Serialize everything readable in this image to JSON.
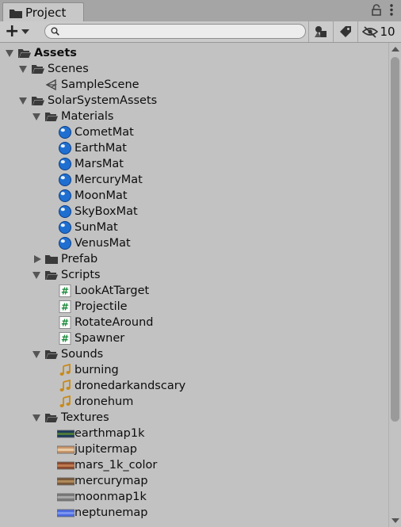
{
  "tab": {
    "title": "Project",
    "icon": "folder-icon"
  },
  "tab_controls": {
    "lock_icon": "lock-icon",
    "menu_icon": "kebab-menu-icon"
  },
  "toolbar": {
    "create_label": "+",
    "search": {
      "value": "",
      "placeholder": ""
    },
    "hidden_count": "10"
  },
  "tree": [
    {
      "label": "Assets",
      "depth": 0,
      "arrow": "open",
      "icon": "folder-open",
      "bold": true
    },
    {
      "label": "Scenes",
      "depth": 1,
      "arrow": "open",
      "icon": "folder-open"
    },
    {
      "label": "SampleScene",
      "depth": 2,
      "arrow": "",
      "icon": "scene"
    },
    {
      "label": "SolarSystemAssets",
      "depth": 1,
      "arrow": "open",
      "icon": "folder-open"
    },
    {
      "label": "Materials",
      "depth": 2,
      "arrow": "open",
      "icon": "folder-open"
    },
    {
      "label": "CometMat",
      "depth": 3,
      "arrow": "",
      "icon": "material"
    },
    {
      "label": "EarthMat",
      "depth": 3,
      "arrow": "",
      "icon": "material"
    },
    {
      "label": "MarsMat",
      "depth": 3,
      "arrow": "",
      "icon": "material"
    },
    {
      "label": "MercuryMat",
      "depth": 3,
      "arrow": "",
      "icon": "material"
    },
    {
      "label": "MoonMat",
      "depth": 3,
      "arrow": "",
      "icon": "material"
    },
    {
      "label": "SkyBoxMat",
      "depth": 3,
      "arrow": "",
      "icon": "material"
    },
    {
      "label": "SunMat",
      "depth": 3,
      "arrow": "",
      "icon": "material"
    },
    {
      "label": "VenusMat",
      "depth": 3,
      "arrow": "",
      "icon": "material"
    },
    {
      "label": "Prefab",
      "depth": 2,
      "arrow": "closed",
      "icon": "folder-closed"
    },
    {
      "label": "Scripts",
      "depth": 2,
      "arrow": "open",
      "icon": "folder-open"
    },
    {
      "label": "LookAtTarget",
      "depth": 3,
      "arrow": "",
      "icon": "script"
    },
    {
      "label": "Projectile",
      "depth": 3,
      "arrow": "",
      "icon": "script"
    },
    {
      "label": "RotateAround",
      "depth": 3,
      "arrow": "",
      "icon": "script"
    },
    {
      "label": "Spawner",
      "depth": 3,
      "arrow": "",
      "icon": "script"
    },
    {
      "label": "Sounds",
      "depth": 2,
      "arrow": "open",
      "icon": "folder-open"
    },
    {
      "label": "burning",
      "depth": 3,
      "arrow": "",
      "icon": "audio"
    },
    {
      "label": "dronedarkandscary",
      "depth": 3,
      "arrow": "",
      "icon": "audio"
    },
    {
      "label": "dronehum",
      "depth": 3,
      "arrow": "",
      "icon": "audio"
    },
    {
      "label": "Textures",
      "depth": 2,
      "arrow": "open",
      "icon": "folder-open"
    },
    {
      "label": "earthmap1k",
      "depth": 3,
      "arrow": "",
      "icon": "texture",
      "swatch": [
        "#1d3b5c",
        "#4d7a3a"
      ]
    },
    {
      "label": "jupitermap",
      "depth": 3,
      "arrow": "",
      "icon": "texture",
      "swatch": [
        "#c9966a",
        "#e9c9a4"
      ]
    },
    {
      "label": "mars_1k_color",
      "depth": 3,
      "arrow": "",
      "icon": "texture",
      "swatch": [
        "#8a4a2e",
        "#c07a4e"
      ]
    },
    {
      "label": "mercurymap",
      "depth": 3,
      "arrow": "",
      "icon": "texture",
      "swatch": [
        "#7a5a3a",
        "#b08a5a"
      ]
    },
    {
      "label": "moonmap1k",
      "depth": 3,
      "arrow": "",
      "icon": "texture",
      "swatch": [
        "#7a7a7a",
        "#a8a8a8"
      ]
    },
    {
      "label": "neptunemap",
      "depth": 3,
      "arrow": "",
      "icon": "texture",
      "swatch": [
        "#4c6ae0",
        "#7a95f0"
      ]
    }
  ],
  "colors": {
    "material_blue": "#1f6fd1",
    "folder_dark": "#3a3a3a",
    "script_green": "#1b8a3a",
    "audio_orange": "#c98a1a"
  }
}
